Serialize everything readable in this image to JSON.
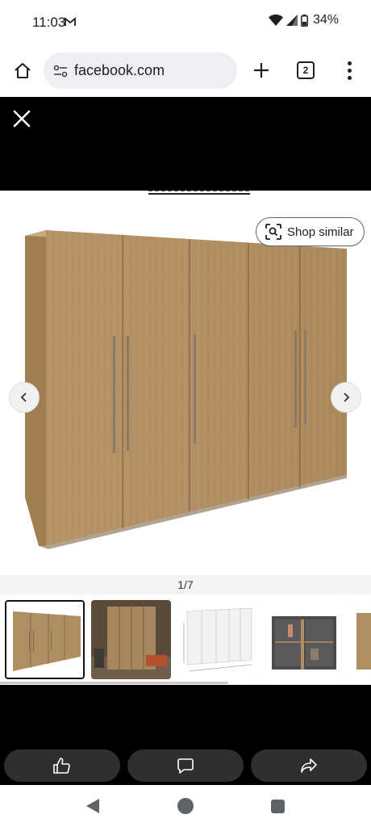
{
  "status_bar": {
    "time": "11:03",
    "battery": "34%",
    "icons": [
      "gmail-icon",
      "wifi-icon",
      "signal-icon",
      "battery-icon"
    ]
  },
  "browser": {
    "url": "facebook.com",
    "tab_count": "2",
    "icons": [
      "home-icon",
      "site-info-icon",
      "new-tab-icon",
      "tabs-icon",
      "more-menu-icon"
    ]
  },
  "viewer": {
    "close_icon": "close-icon",
    "shop_similar_label": "Shop similar",
    "shop_similar_icon": "lens-search-icon",
    "prev_icon": "chevron-left-icon",
    "next_icon": "chevron-right-icon",
    "counter": "1/7",
    "wood_color": "#b08e63"
  },
  "thumbnails": [
    {
      "name": "wardrobe-oak-front",
      "active": true
    },
    {
      "name": "wardrobe-room-scene",
      "active": false
    },
    {
      "name": "wardrobe-white-dimensions",
      "active": false
    },
    {
      "name": "wardrobe-open-interior",
      "active": false
    },
    {
      "name": "wardrobe-partial",
      "active": false
    }
  ],
  "actions": {
    "icons": [
      "like-icon",
      "comment-icon",
      "share-icon"
    ]
  },
  "system_nav": {
    "icons": [
      "back-icon",
      "home-circle-icon",
      "recents-icon"
    ]
  }
}
